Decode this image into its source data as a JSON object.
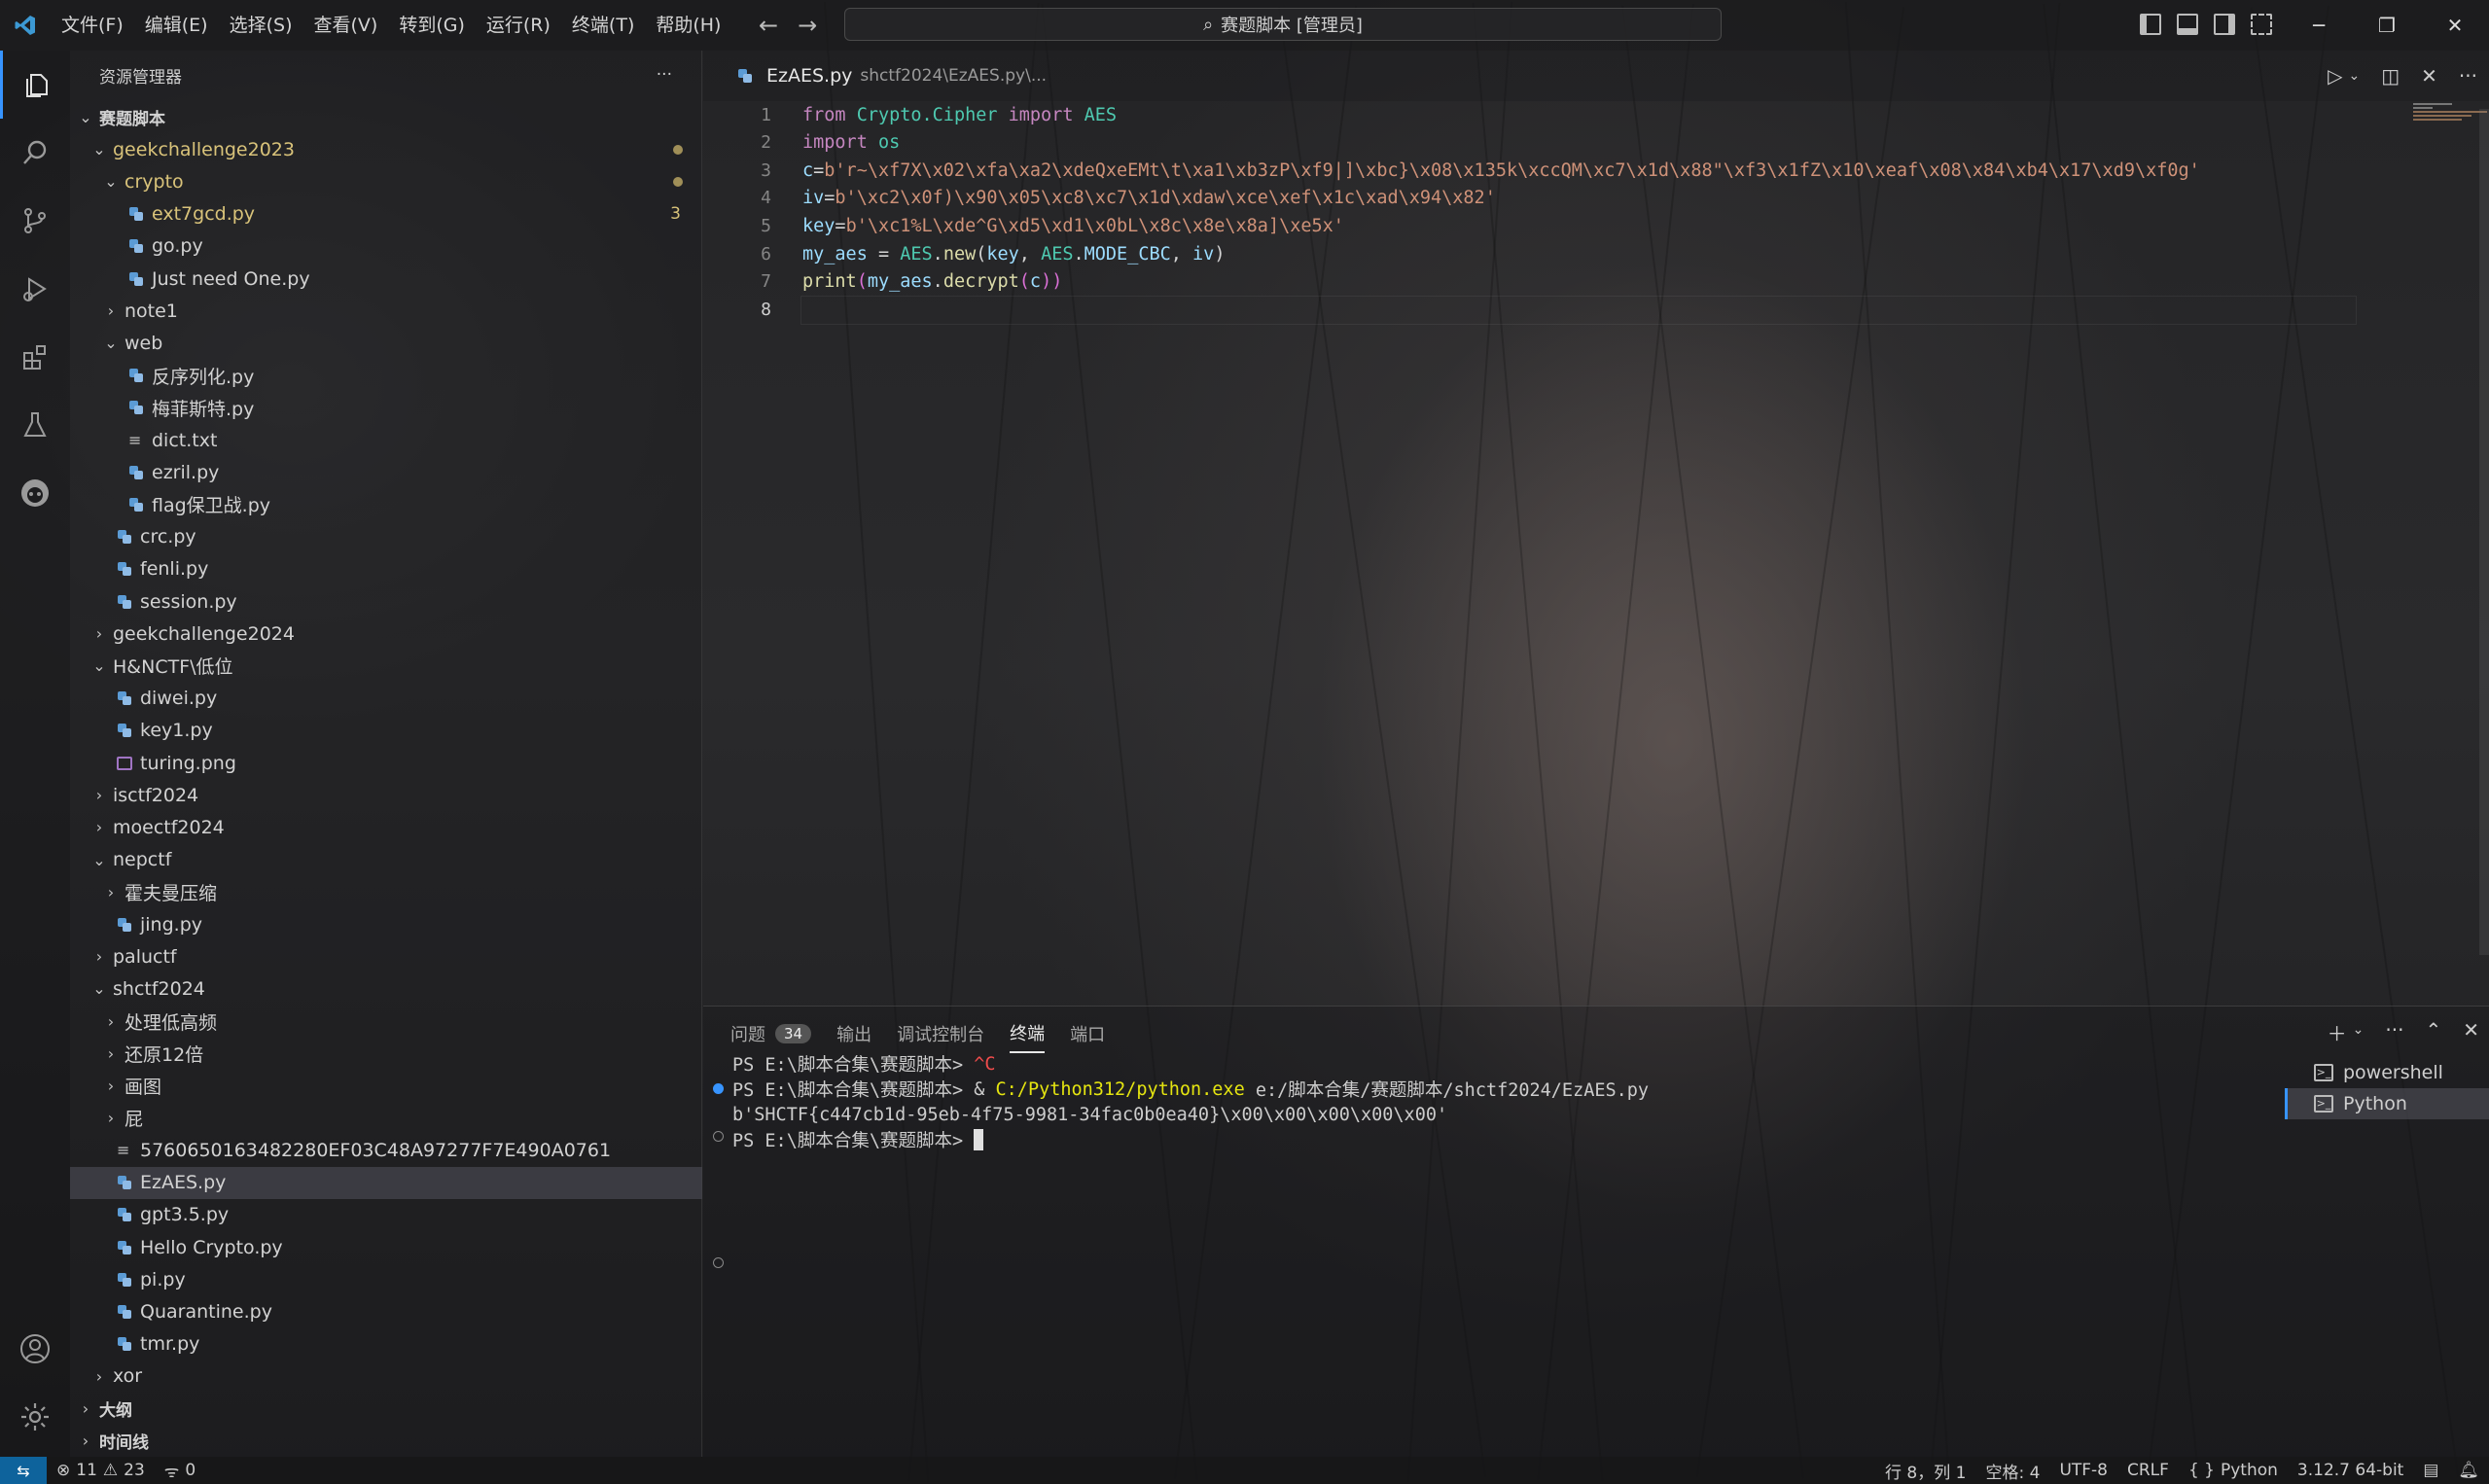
{
  "window": {
    "title": "赛题脚本 [管理员]"
  },
  "menu": [
    "文件(F)",
    "编辑(E)",
    "选择(S)",
    "查看(V)",
    "转到(G)",
    "运行(R)",
    "终端(T)",
    "帮助(H)"
  ],
  "sidebar": {
    "title": "资源管理器",
    "more": "···",
    "tree": [
      {
        "label": "赛题脚本",
        "depth": 0,
        "kind": "section",
        "open": true
      },
      {
        "label": "geekchallenge2023",
        "depth": 1,
        "kind": "folder",
        "open": true,
        "modified": true
      },
      {
        "label": "crypto",
        "depth": 2,
        "kind": "folder",
        "open": true,
        "modified": true
      },
      {
        "label": "ext7gcd.py",
        "depth": 3,
        "kind": "py",
        "modified": true,
        "badge": "3"
      },
      {
        "label": "go.py",
        "depth": 3,
        "kind": "py"
      },
      {
        "label": "Just need One.py",
        "depth": 3,
        "kind": "py"
      },
      {
        "label": "note1",
        "depth": 2,
        "kind": "folder",
        "open": false
      },
      {
        "label": "web",
        "depth": 2,
        "kind": "folder",
        "open": true
      },
      {
        "label": "反序列化.py",
        "depth": 3,
        "kind": "py"
      },
      {
        "label": "梅菲斯特.py",
        "depth": 3,
        "kind": "py"
      },
      {
        "label": "dict.txt",
        "depth": 3,
        "kind": "txt"
      },
      {
        "label": "ezril.py",
        "depth": 3,
        "kind": "py"
      },
      {
        "label": "flag保卫战.py",
        "depth": 3,
        "kind": "py"
      },
      {
        "label": "crc.py",
        "depth": 2,
        "kind": "py"
      },
      {
        "label": "fenli.py",
        "depth": 2,
        "kind": "py"
      },
      {
        "label": "session.py",
        "depth": 2,
        "kind": "py"
      },
      {
        "label": "geekchallenge2024",
        "depth": 1,
        "kind": "folder",
        "open": false
      },
      {
        "label": "H&NCTF\\低位",
        "depth": 1,
        "kind": "folder",
        "open": true
      },
      {
        "label": "diwei.py",
        "depth": 2,
        "kind": "py"
      },
      {
        "label": "key1.py",
        "depth": 2,
        "kind": "py"
      },
      {
        "label": "turing.png",
        "depth": 2,
        "kind": "img"
      },
      {
        "label": "isctf2024",
        "depth": 1,
        "kind": "folder",
        "open": false
      },
      {
        "label": "moectf2024",
        "depth": 1,
        "kind": "folder",
        "open": false
      },
      {
        "label": "nepctf",
        "depth": 1,
        "kind": "folder",
        "open": true
      },
      {
        "label": "霍夫曼压缩",
        "depth": 2,
        "kind": "folder",
        "open": false
      },
      {
        "label": "jing.py",
        "depth": 2,
        "kind": "py"
      },
      {
        "label": "paluctf",
        "depth": 1,
        "kind": "folder",
        "open": false
      },
      {
        "label": "shctf2024",
        "depth": 1,
        "kind": "folder",
        "open": true
      },
      {
        "label": "处理低高频",
        "depth": 2,
        "kind": "folder",
        "open": false
      },
      {
        "label": "还原12倍",
        "depth": 2,
        "kind": "folder",
        "open": false
      },
      {
        "label": "画图",
        "depth": 2,
        "kind": "folder",
        "open": false
      },
      {
        "label": "屁",
        "depth": 2,
        "kind": "folder",
        "open": false
      },
      {
        "label": "5760650163482280EF03C48A97277F7E490A0761",
        "depth": 2,
        "kind": "txt"
      },
      {
        "label": "EzAES.py",
        "depth": 2,
        "kind": "py",
        "selected": true
      },
      {
        "label": "gpt3.5.py",
        "depth": 2,
        "kind": "py"
      },
      {
        "label": "Hello Crypto.py",
        "depth": 2,
        "kind": "py"
      },
      {
        "label": "pi.py",
        "depth": 2,
        "kind": "py"
      },
      {
        "label": "Quarantine.py",
        "depth": 2,
        "kind": "py"
      },
      {
        "label": "tmr.py",
        "depth": 2,
        "kind": "py"
      },
      {
        "label": "xor",
        "depth": 1,
        "kind": "folder",
        "open": false
      },
      {
        "label": "大纲",
        "depth": 0,
        "kind": "section",
        "open": false
      },
      {
        "label": "时间线",
        "depth": 0,
        "kind": "section",
        "open": false
      }
    ]
  },
  "tab": {
    "filename": "EzAES.py",
    "path": "shctf2024\\EzAES.py\\..."
  },
  "editor": {
    "line_numbers": [
      "1",
      "2",
      "3",
      "4",
      "5",
      "6",
      "7",
      "8"
    ],
    "current_line": "8",
    "lines": [
      [
        [
          "kw",
          "from"
        ],
        [
          "pun",
          " "
        ],
        [
          "mod",
          "Crypto.Cipher"
        ],
        [
          "pun",
          " "
        ],
        [
          "kw",
          "import"
        ],
        [
          "pun",
          " "
        ],
        [
          "mod",
          "AES"
        ]
      ],
      [
        [
          "kw",
          "import"
        ],
        [
          "pun",
          " "
        ],
        [
          "mod",
          "os"
        ]
      ],
      [
        [
          "var",
          "c"
        ],
        [
          "pun",
          "="
        ],
        [
          "str",
          "b'r~\\xf7X\\x02\\xfa\\xa2\\xdeQxeEMt\\t\\xa1\\xb3zP\\xf9|]\\xbc}\\x08\\x135k\\xccQM\\xc7\\x1d\\x88\"\\xf3\\x1fZ\\x10\\xeaf\\x08\\x84\\xb4\\x17\\xd9\\xf0g'"
        ]
      ],
      [
        [
          "var",
          "iv"
        ],
        [
          "pun",
          "="
        ],
        [
          "str",
          "b'\\xc2\\x0f)\\x90\\x05\\xc8\\xc7\\x1d\\xdaw\\xce\\xef\\x1c\\xad\\x94\\x82'"
        ]
      ],
      [
        [
          "var",
          "key"
        ],
        [
          "pun",
          "="
        ],
        [
          "str",
          "b'\\xc1%L\\xde^G\\xd5\\xd1\\x0bL\\x8c\\x8e\\x8a]\\xe5x'"
        ]
      ],
      [
        [
          "var",
          "my_aes"
        ],
        [
          "pun",
          " = "
        ],
        [
          "mod",
          "AES"
        ],
        [
          "pun",
          "."
        ],
        [
          "fn",
          "new"
        ],
        [
          "pun",
          "("
        ],
        [
          "var",
          "key"
        ],
        [
          "pun",
          ", "
        ],
        [
          "mod",
          "AES"
        ],
        [
          "pun",
          "."
        ],
        [
          "var",
          "MODE_CBC"
        ],
        [
          "pun",
          ", "
        ],
        [
          "var",
          "iv"
        ],
        [
          "pun",
          ")"
        ]
      ],
      [
        [
          "fn",
          "print"
        ],
        [
          "br",
          "("
        ],
        [
          "var",
          "my_aes"
        ],
        [
          "pun",
          "."
        ],
        [
          "fn",
          "decrypt"
        ],
        [
          "br",
          "("
        ],
        [
          "var",
          "c"
        ],
        [
          "br",
          "))"
        ]
      ],
      []
    ]
  },
  "panel": {
    "tabs": [
      {
        "label": "问题",
        "badge": "34"
      },
      {
        "label": "输出"
      },
      {
        "label": "调试控制台"
      },
      {
        "label": "终端",
        "active": true
      },
      {
        "label": "端口"
      }
    ],
    "terminal": [
      [
        [
          "t-path",
          "PS E:\\脚本合集\\赛题脚本> "
        ],
        [
          "t-red",
          "^C"
        ]
      ],
      [
        [
          "t-path",
          "PS E:\\脚本合集\\赛题脚本> "
        ],
        [
          "t-path",
          "& "
        ],
        [
          "t-yel",
          "C:/Python312/python.exe"
        ],
        [
          "t-path",
          " e:/脚本合集/赛题脚本/shctf2024/EzAES.py"
        ]
      ],
      [
        [
          "t-path",
          "b'SHCTF{c447cb1d-95eb-4f75-9981-34fac0b0ea40}\\x00\\x00\\x00\\x00\\x00'"
        ]
      ],
      [
        [
          "t-path",
          "PS E:\\脚本合集\\赛题脚本> "
        ]
      ]
    ],
    "terminal_list": [
      {
        "label": "powershell"
      },
      {
        "label": "Python",
        "active": true
      }
    ]
  },
  "status": {
    "errors": "11",
    "warnings": "23",
    "ports": "0",
    "position": "行 8，列 1",
    "spaces": "空格: 4",
    "encoding": "UTF-8",
    "eol": "CRLF",
    "language": "Python",
    "interpreter": "3.12.7 64-bit",
    "language_braces": "{ }"
  },
  "colors": {
    "accent": "#3794ff",
    "remote": "#0e639c",
    "modified": "#d9c37a"
  }
}
